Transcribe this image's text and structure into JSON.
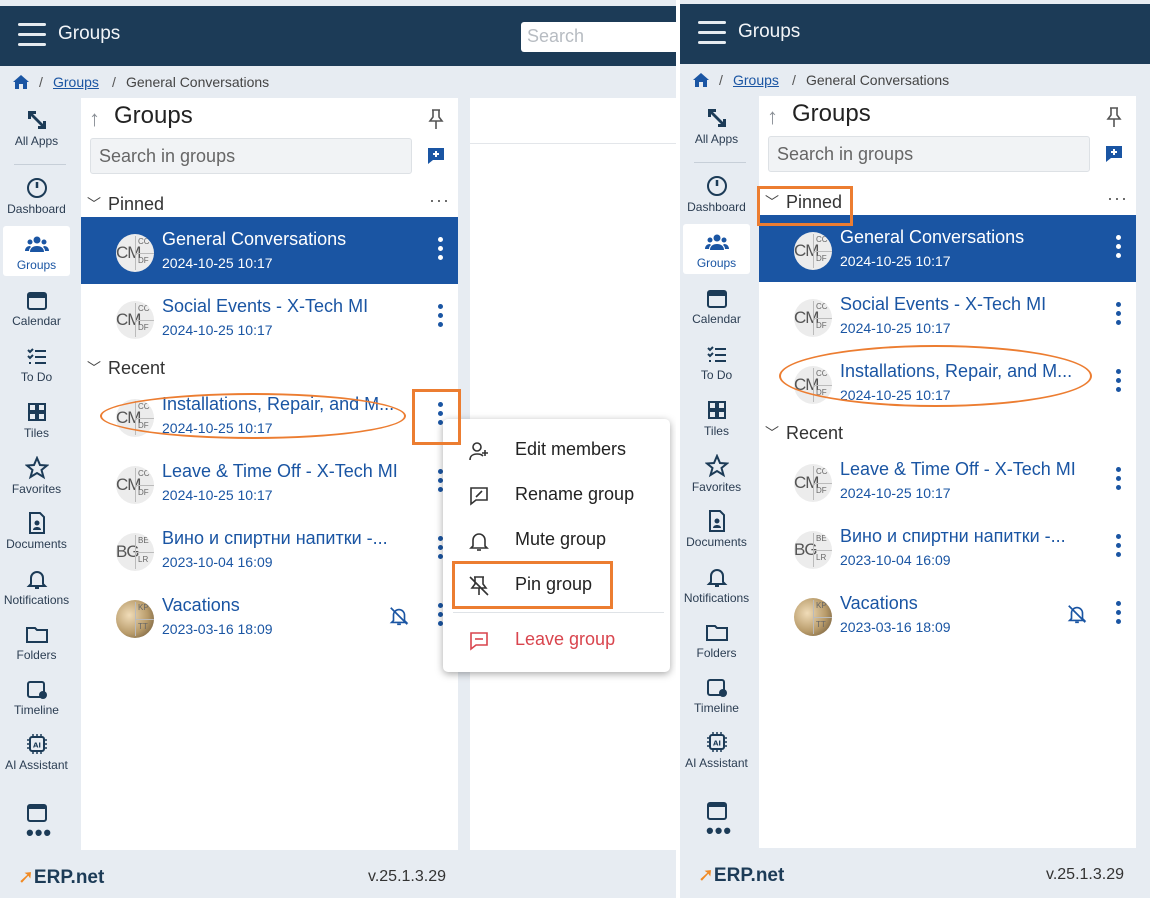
{
  "app": {
    "title": "Groups",
    "search_placeholder": "Search",
    "version": "v.25.1.3.29",
    "logo": "ERP.net"
  },
  "breadcrumb": {
    "groups": "Groups",
    "current": "General Conversations",
    "sep": "/"
  },
  "rail": [
    {
      "label": "All Apps",
      "icon": "expand-icon"
    },
    {
      "label": "Dashboard",
      "icon": "dashboard-icon"
    },
    {
      "label": "Groups",
      "icon": "groups-icon"
    },
    {
      "label": "Calendar",
      "icon": "calendar-icon"
    },
    {
      "label": "To Do",
      "icon": "todo-icon"
    },
    {
      "label": "Tiles",
      "icon": "tiles-icon"
    },
    {
      "label": "Favorites",
      "icon": "star-icon"
    },
    {
      "label": "Documents",
      "icon": "document-icon"
    },
    {
      "label": "Notifications",
      "icon": "bell-icon"
    },
    {
      "label": "Folders",
      "icon": "folder-icon"
    },
    {
      "label": "Timeline",
      "icon": "timeline-icon"
    },
    {
      "label": "AI Assistant",
      "icon": "ai-chip-icon"
    },
    {
      "label": "",
      "icon": "window-icon"
    }
  ],
  "rail_more": "•••",
  "list": {
    "title": "Groups",
    "search_placeholder": "Search in groups",
    "pinned_label": "Pinned",
    "recent_label": "Recent",
    "section_more": "···"
  },
  "left": {
    "pinned": [
      {
        "title": "General Conversations",
        "date": "2024-10-25 10:17",
        "avatar": {
          "big": "CM",
          "q1": "CC",
          "q2": "DF"
        }
      },
      {
        "title": "Social Events - X-Tech MI",
        "date": "2024-10-25 10:17",
        "avatar": {
          "big": "CM",
          "q1": "CC",
          "q2": "DF"
        }
      }
    ],
    "recent": [
      {
        "title": "Installations, Repair, and M...",
        "date": "2024-10-25 10:17",
        "avatar": {
          "big": "CM",
          "q1": "CC",
          "q2": "DF"
        }
      },
      {
        "title": "Leave & Time Off - X-Tech MI",
        "date": "2024-10-25 10:17",
        "avatar": {
          "big": "CM",
          "q1": "CC",
          "q2": "DF"
        }
      },
      {
        "title": "Вино и спиртни напитки -...",
        "date": "2023-10-04 16:09",
        "avatar": {
          "big": "BG",
          "q1": "BE",
          "q2": "LR"
        }
      },
      {
        "title": "Vacations",
        "date": "2023-03-16 18:09",
        "avatar": {
          "big": "",
          "q1": "KP",
          "q2": "TT"
        }
      }
    ]
  },
  "right": {
    "pinned": [
      {
        "title": "General Conversations",
        "date": "2024-10-25 10:17",
        "avatar": {
          "big": "CM",
          "q1": "CC",
          "q2": "DF"
        }
      },
      {
        "title": "Social Events - X-Tech MI",
        "date": "2024-10-25 10:17",
        "avatar": {
          "big": "CM",
          "q1": "CC",
          "q2": "DF"
        }
      },
      {
        "title": "Installations, Repair, and M...",
        "date": "2024-10-25 10:17",
        "avatar": {
          "big": "CM",
          "q1": "CC",
          "q2": "DF"
        }
      }
    ],
    "recent": [
      {
        "title": "Leave & Time Off - X-Tech MI",
        "date": "2024-10-25 10:17",
        "avatar": {
          "big": "CM",
          "q1": "CC",
          "q2": "DF"
        }
      },
      {
        "title": "Вино и спиртни напитки -...",
        "date": "2023-10-04 16:09",
        "avatar": {
          "big": "BG",
          "q1": "BE",
          "q2": "LR"
        }
      },
      {
        "title": "Vacations",
        "date": "2023-03-16 18:09",
        "avatar": {
          "big": "",
          "q1": "KP",
          "q2": "TT"
        }
      }
    ]
  },
  "context_menu": {
    "items": [
      {
        "label": "Edit members",
        "icon": "add-person-icon"
      },
      {
        "label": "Rename group",
        "icon": "rename-icon"
      },
      {
        "label": "Mute group",
        "icon": "bell-icon"
      },
      {
        "label": "Pin group",
        "icon": "pin-off-icon"
      },
      {
        "label": "Leave group",
        "icon": "leave-icon"
      }
    ]
  },
  "colors": {
    "header": "#1c3b57",
    "accent": "#1a55a3",
    "highlight": "#ec7d31",
    "danger": "#d9454e",
    "logo_mark": "#f08a24"
  }
}
